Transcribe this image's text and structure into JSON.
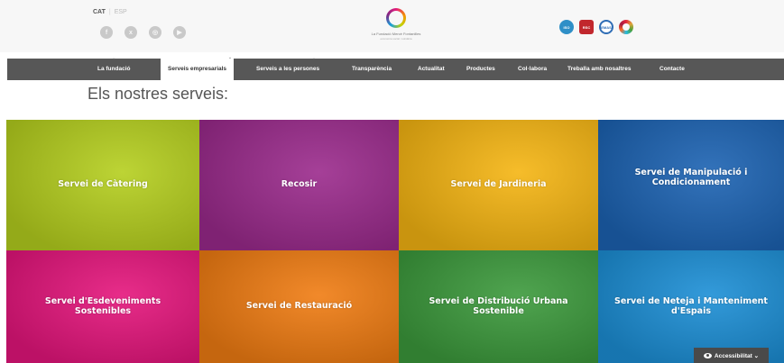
{
  "header": {
    "lang_active": "CAT",
    "lang_other": "ESP",
    "social": [
      {
        "icon": "facebook-icon",
        "glyph": "f"
      },
      {
        "icon": "twitter-icon",
        "glyph": "x"
      },
      {
        "icon": "instagram-icon",
        "glyph": "◎"
      },
      {
        "icon": "youtube-icon",
        "glyph": "▶"
      }
    ],
    "logo_name": "La Fundació Mercè Fontanilles",
    "logo_tagline": "economia social i solidària",
    "certifications": [
      {
        "icon": "cert-badge-icon",
        "text": "ISO"
      },
      {
        "icon": "cert-badge-icon",
        "text": "RSC"
      },
      {
        "icon": "cert-badge-icon",
        "text": "EMAS"
      },
      {
        "icon": "sdg-wheel-icon",
        "text": ""
      }
    ]
  },
  "nav": {
    "items": [
      {
        "label": "La fundació",
        "has_sub": true
      },
      {
        "label": "Serveis empresarials",
        "has_sub": true
      },
      {
        "label": "Serveis a les persones",
        "has_sub": true
      },
      {
        "label": "Transparència",
        "has_sub": false
      },
      {
        "label": "Actualitat",
        "has_sub": false
      },
      {
        "label": "Productes",
        "has_sub": false
      },
      {
        "label": "Col·labora",
        "has_sub": false
      },
      {
        "label": "Treballa amb nosaltres",
        "has_sub": false
      },
      {
        "label": "Contacte",
        "has_sub": false
      }
    ],
    "active_index": 1
  },
  "page": {
    "title": "Els nostres serveis:"
  },
  "services": [
    {
      "label": "Servei de Càtering",
      "color": "#b5cf1e"
    },
    {
      "label": "Recosir",
      "color": "#9b2a8c"
    },
    {
      "label": "Servei de Jardineria",
      "color": "#f5b512"
    },
    {
      "label": "Servei de Manipulació i Condicionament",
      "color": "#1c63b3"
    },
    {
      "label": "Servei d'Esdeveniments Sostenibles",
      "color": "#e5157c"
    },
    {
      "label": "Servei de Restauració",
      "color": "#f07c12"
    },
    {
      "label": "Servei de Distribució Urbana Sostenible",
      "color": "#3c9a3c"
    },
    {
      "label": "Servei de Neteja i Manteniment d'Espais",
      "color": "#1c8fd6"
    }
  ],
  "accessibility": {
    "label": "Accessibilitat ⌄"
  }
}
